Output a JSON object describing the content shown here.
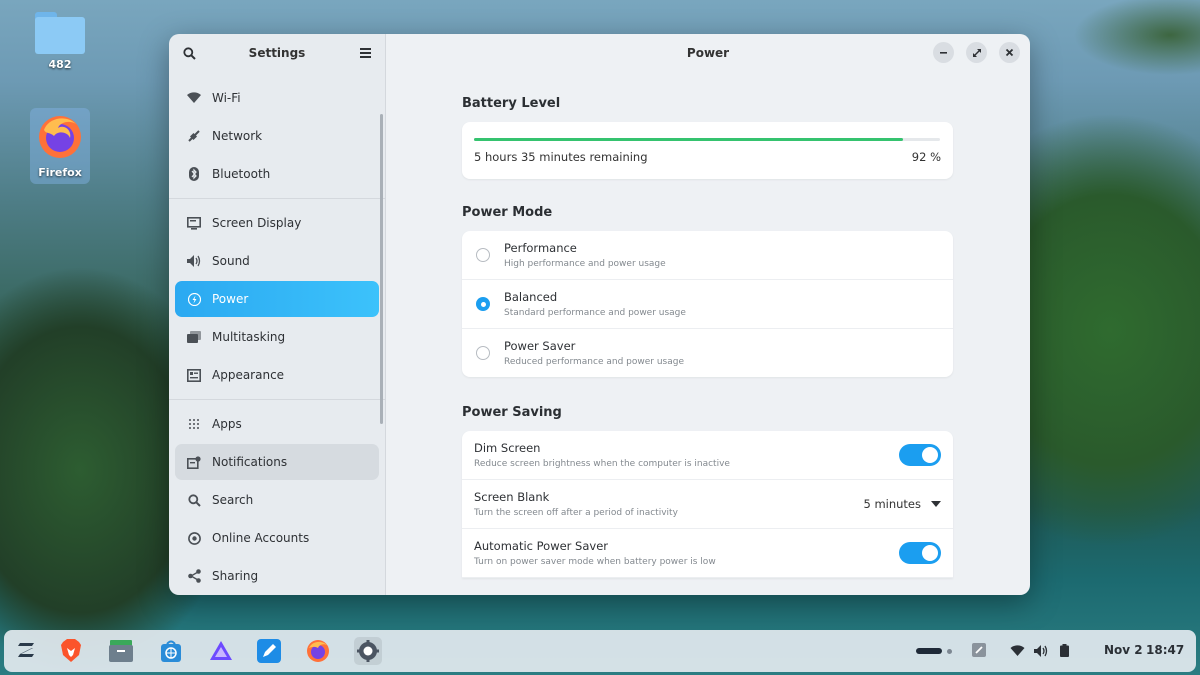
{
  "desktop": {
    "icons": [
      {
        "label": "482",
        "type": "folder-icon"
      },
      {
        "label": "Firefox",
        "type": "firefox-icon"
      }
    ]
  },
  "sidebar": {
    "title": "Settings",
    "items": [
      {
        "label": "Wi-Fi",
        "icon": "wifi-icon"
      },
      {
        "label": "Network",
        "icon": "network-icon"
      },
      {
        "label": "Bluetooth",
        "icon": "bluetooth-icon"
      },
      {
        "label": "Screen Display",
        "icon": "display-icon"
      },
      {
        "label": "Sound",
        "icon": "speaker-icon"
      },
      {
        "label": "Power",
        "icon": "power-icon"
      },
      {
        "label": "Multitasking",
        "icon": "multitasking-icon"
      },
      {
        "label": "Appearance",
        "icon": "appearance-icon"
      },
      {
        "label": "Apps",
        "icon": "apps-grid-icon"
      },
      {
        "label": "Notifications",
        "icon": "notifications-icon"
      },
      {
        "label": "Search",
        "icon": "search-icon"
      },
      {
        "label": "Online Accounts",
        "icon": "online-accounts-icon"
      },
      {
        "label": "Sharing",
        "icon": "share-icon"
      }
    ],
    "active": "Power"
  },
  "main": {
    "title": "Power",
    "battery": {
      "section_title": "Battery Level",
      "remaining": "5 hours 35 minutes remaining",
      "percent_label": "92 %",
      "level": 0.92
    },
    "power_mode": {
      "section_title": "Power Mode",
      "options": [
        {
          "title": "Performance",
          "subtitle": "High performance and power usage",
          "selected": false
        },
        {
          "title": "Balanced",
          "subtitle": "Standard performance and power usage",
          "selected": true
        },
        {
          "title": "Power Saver",
          "subtitle": "Reduced performance and power usage",
          "selected": false
        }
      ]
    },
    "power_saving": {
      "section_title": "Power Saving",
      "dim_screen": {
        "title": "Dim Screen",
        "subtitle": "Reduce screen brightness when the computer is inactive",
        "enabled": true
      },
      "screen_blank": {
        "title": "Screen Blank",
        "subtitle": "Turn the screen off after a period of inactivity",
        "value": "5 minutes"
      },
      "auto_power_saver": {
        "title": "Automatic Power Saver",
        "subtitle": "Turn on power saver mode when battery power is low",
        "enabled": true
      }
    }
  },
  "taskbar": {
    "apps": [
      "zorin-menu-icon",
      "brave-icon",
      "files-icon",
      "software-store-icon",
      "proton-vpn-icon",
      "text-editor-icon",
      "firefox-icon",
      "settings-icon"
    ],
    "date": "Nov 2",
    "time": "18:47"
  },
  "colors": {
    "accent": "#1b9ef0",
    "battery_bar": "#35c36f"
  }
}
